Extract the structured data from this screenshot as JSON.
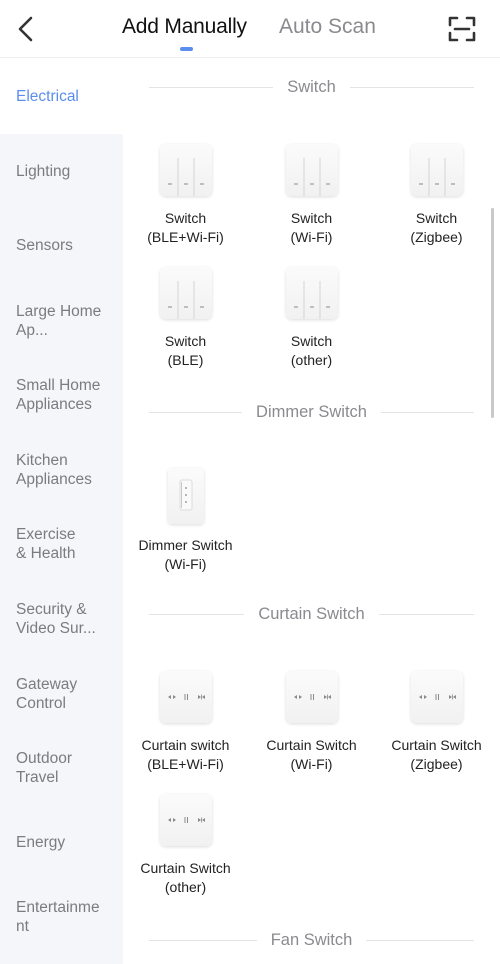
{
  "header": {
    "back_icon": "chevron-left-icon",
    "tabs": [
      {
        "label": "Add Manually",
        "active": true
      },
      {
        "label": "Auto Scan",
        "active": false
      }
    ],
    "scan_icon": "scan-frame-icon",
    "accent_color": "#5b8def"
  },
  "sidebar": {
    "items": [
      {
        "label": "Electrical",
        "active": true
      },
      {
        "label": "Lighting",
        "active": false
      },
      {
        "label": "Sensors",
        "active": false
      },
      {
        "label": "Large Home Ap...",
        "active": false
      },
      {
        "label": "Small Home Appliances",
        "active": false
      },
      {
        "label": "Kitchen Appliances",
        "active": false
      },
      {
        "label": "Exercise & Health",
        "active": false
      },
      {
        "label": "Security & Video Sur...",
        "active": false
      },
      {
        "label": "Gateway Control",
        "active": false
      },
      {
        "label": "Outdoor Travel",
        "active": false
      },
      {
        "label": "Energy",
        "active": false
      },
      {
        "label": "Entertainment",
        "active": false
      }
    ],
    "active_color": "#5b8def"
  },
  "sections": [
    {
      "title": "Switch",
      "devices": [
        {
          "line1": "Switch",
          "line2": "(BLE+Wi-Fi)",
          "icon": "wall-switch-icon"
        },
        {
          "line1": "Switch",
          "line2": "(Wi-Fi)",
          "icon": "wall-switch-icon"
        },
        {
          "line1": "Switch",
          "line2": "(Zigbee)",
          "icon": "wall-switch-icon"
        },
        {
          "line1": "Switch",
          "line2": "(BLE)",
          "icon": "wall-switch-icon"
        },
        {
          "line1": "Switch",
          "line2": "(other)",
          "icon": "wall-switch-icon"
        }
      ]
    },
    {
      "title": "Dimmer Switch",
      "devices": [
        {
          "line1": "Dimmer Switch",
          "line2": "(Wi-Fi)",
          "icon": "dimmer-switch-icon"
        }
      ]
    },
    {
      "title": "Curtain Switch",
      "devices": [
        {
          "line1": "Curtain switch",
          "line2": "(BLE+Wi-Fi)",
          "icon": "curtain-switch-icon"
        },
        {
          "line1": "Curtain Switch",
          "line2": "(Wi-Fi)",
          "icon": "curtain-switch-icon"
        },
        {
          "line1": "Curtain Switch",
          "line2": "(Zigbee)",
          "icon": "curtain-switch-icon"
        },
        {
          "line1": "Curtain Switch",
          "line2": "(other)",
          "icon": "curtain-switch-icon"
        }
      ]
    },
    {
      "title": "Fan Switch",
      "devices": []
    }
  ]
}
